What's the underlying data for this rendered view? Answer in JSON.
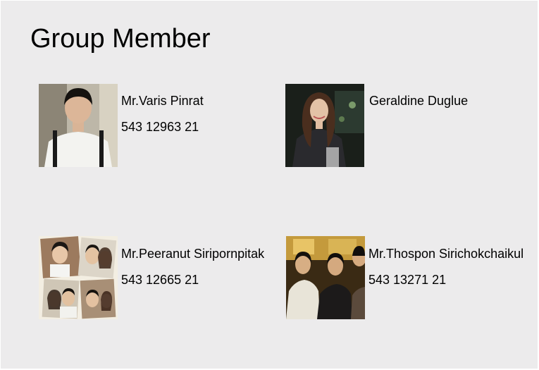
{
  "title": "Group Member",
  "members": [
    {
      "name": "Mr.Varis Pinrat",
      "id": "543 12963 21",
      "photo": "portrait-photo"
    },
    {
      "name": "Geraldine Duglue",
      "id": "",
      "photo": "portrait-photo"
    },
    {
      "name": "Mr.Peeranut Siripornpitak",
      "id": "543 12665 21",
      "photo": "photo-collage"
    },
    {
      "name": "Mr.Thospon Sirichokchaikul",
      "id": "543 13271 21",
      "photo": "group-photo"
    }
  ]
}
